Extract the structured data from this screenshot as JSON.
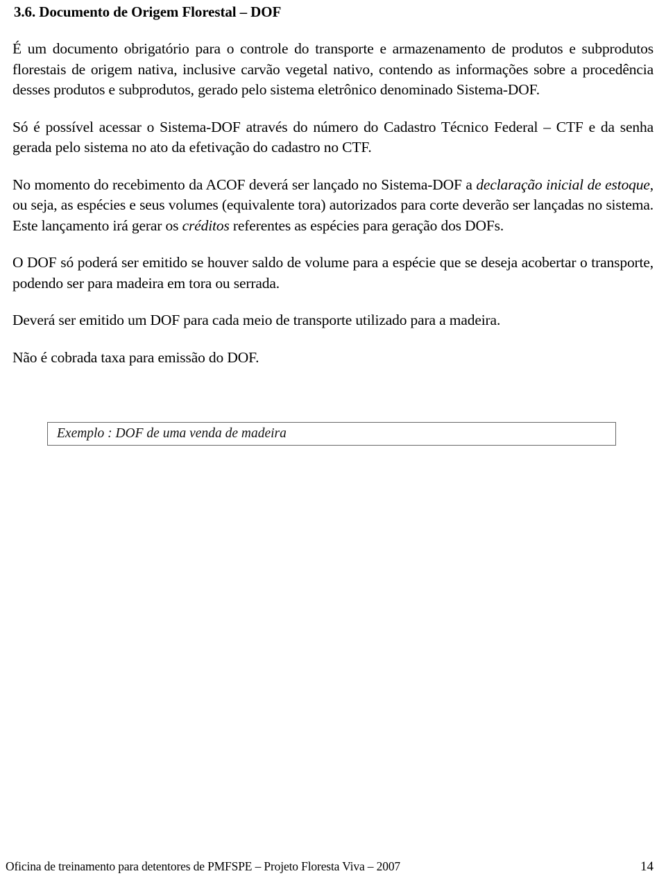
{
  "document": {
    "heading": "3.6. Documento de Origem Florestal – DOF",
    "paragraphs": {
      "p1": "É um documento obrigatório para o controle do transporte e armazenamento de produtos e subprodutos florestais de origem nativa, inclusive carvão vegetal nativo, contendo as informações sobre a procedência desses produtos e subprodutos, gerado pelo sistema eletrônico denominado Sistema-DOF.",
      "p2": "Só é possível acessar o Sistema-DOF através do número do Cadastro Técnico Federal – CTF e da senha gerada pelo sistema no ato da efetivação do cadastro no CTF.",
      "p3_part1": "No momento do recebimento da ACOF deverá ser lançado no Sistema-DOF a ",
      "p3_italic1": "declaração inicial de estoque",
      "p3_part2": ", ou seja, as espécies e seus volumes (equivalente tora) autorizados para corte deverão ser lançadas no sistema. Este lançamento irá gerar os ",
      "p3_italic2": "créditos",
      "p3_part3": " referentes as espécies para geração dos DOFs.",
      "p4": "O DOF só poderá ser emitido se houver saldo de volume para a espécie que se deseja acobertar o transporte, podendo ser para madeira em tora ou serrada.",
      "p5": "Deverá ser emitido um DOF para cada meio de transporte utilizado para a madeira.",
      "p6": "Não é cobrada taxa para emissão do DOF."
    },
    "example_box": {
      "text": "Exemplo : DOF  de uma venda de madeira"
    },
    "footer": {
      "text": "Oficina de treinamento para detentores de PMFSPE – Projeto Floresta Viva – 2007",
      "page_number": "14"
    },
    "colors": {
      "text": "#000000",
      "box_border": "#666666",
      "background": "#ffffff"
    }
  }
}
